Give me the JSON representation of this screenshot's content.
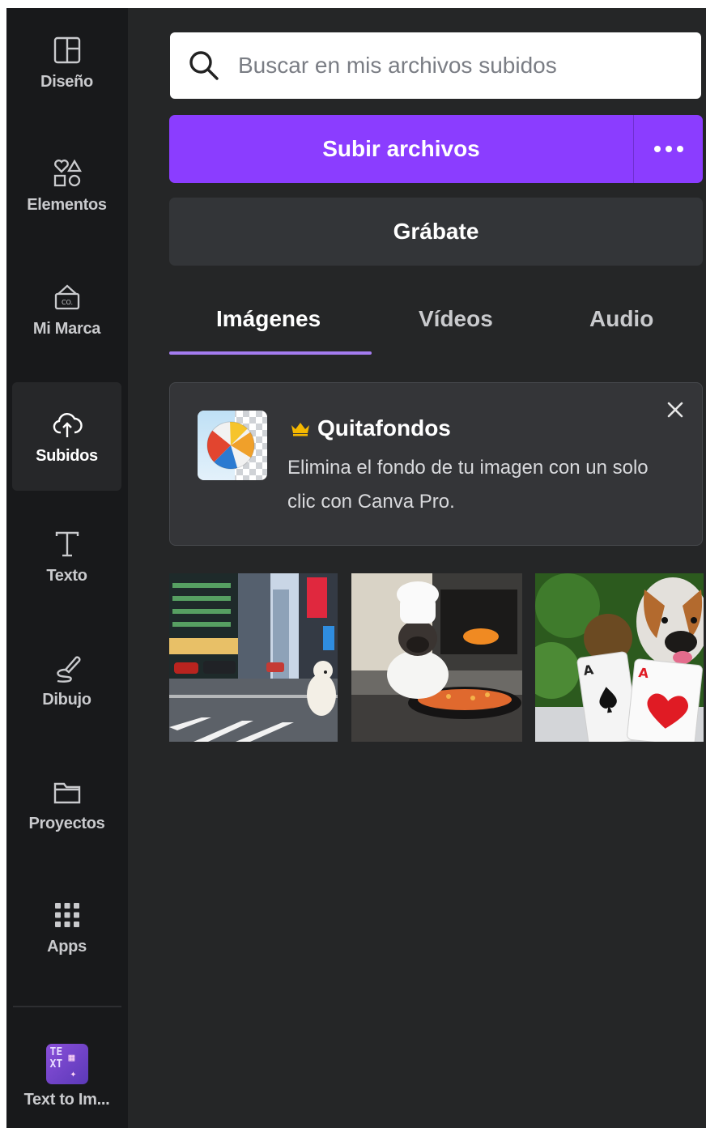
{
  "sidebar": {
    "items": [
      {
        "label": "Diseño",
        "icon": "layout-icon"
      },
      {
        "label": "Elementos",
        "icon": "shapes-icon"
      },
      {
        "label": "Mi Marca",
        "icon": "brand-icon"
      },
      {
        "label": "Subidos",
        "icon": "cloud-upload-icon",
        "active": true
      },
      {
        "label": "Texto",
        "icon": "text-icon"
      },
      {
        "label": "Dibujo",
        "icon": "draw-icon"
      },
      {
        "label": "Proyectos",
        "icon": "folder-icon"
      },
      {
        "label": "Apps",
        "icon": "apps-grid-icon"
      }
    ],
    "app": {
      "label": "Text to Im...",
      "icon": "text-to-image-app-icon"
    }
  },
  "search": {
    "placeholder": "Buscar en mis archivos subidos",
    "value": ""
  },
  "upload": {
    "label": "Subir archivos"
  },
  "record": {
    "label": "Grábate"
  },
  "tabs": [
    {
      "label": "Imágenes",
      "active": true
    },
    {
      "label": "Vídeos"
    },
    {
      "label": "Audio"
    }
  ],
  "promo": {
    "title": "Quitafondos",
    "text": "Elimina el fondo de tu imagen con un solo clic con Canva Pro."
  },
  "uploads": [
    {
      "description": "dog on city street"
    },
    {
      "description": "pug chef cooking"
    },
    {
      "description": "dog with playing cards"
    }
  ],
  "colors": {
    "accent": "#8b3dff",
    "tab_indicator": "#a47cf0",
    "crown": "#f5b800",
    "panel_bg": "#252627",
    "rail_bg": "#18191b"
  }
}
